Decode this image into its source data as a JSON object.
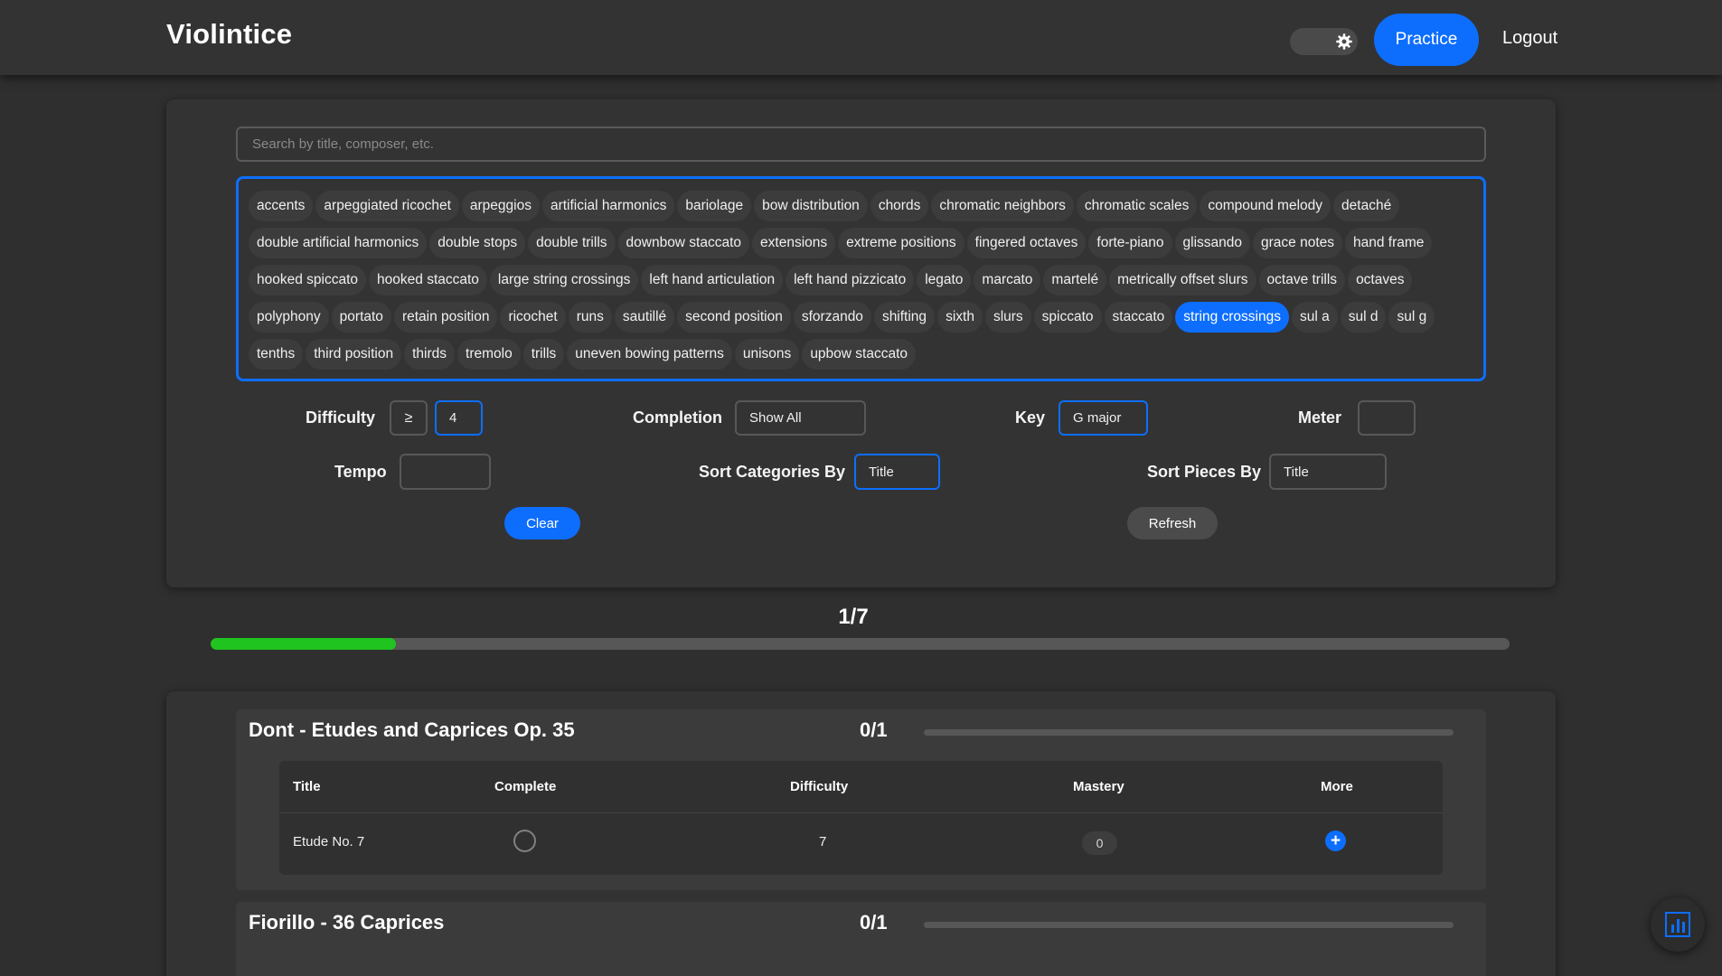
{
  "header": {
    "brand": "Violintice",
    "practice_label": "Practice",
    "logout_label": "Logout",
    "theme_icon": "gear-icon"
  },
  "search": {
    "placeholder": "Search by title, composer, etc.",
    "value": ""
  },
  "tags": [
    {
      "label": "accents",
      "selected": false
    },
    {
      "label": "arpeggiated ricochet",
      "selected": false
    },
    {
      "label": "arpeggios",
      "selected": false
    },
    {
      "label": "artificial harmonics",
      "selected": false
    },
    {
      "label": "bariolage",
      "selected": false
    },
    {
      "label": "bow distribution",
      "selected": false
    },
    {
      "label": "chords",
      "selected": false
    },
    {
      "label": "chromatic neighbors",
      "selected": false
    },
    {
      "label": "chromatic scales",
      "selected": false
    },
    {
      "label": "compound melody",
      "selected": false
    },
    {
      "label": "detaché",
      "selected": false
    },
    {
      "label": "double artificial harmonics",
      "selected": false
    },
    {
      "label": "double stops",
      "selected": false
    },
    {
      "label": "double trills",
      "selected": false
    },
    {
      "label": "downbow staccato",
      "selected": false
    },
    {
      "label": "extensions",
      "selected": false
    },
    {
      "label": "extreme positions",
      "selected": false
    },
    {
      "label": "fingered octaves",
      "selected": false
    },
    {
      "label": "forte-piano",
      "selected": false
    },
    {
      "label": "glissando",
      "selected": false
    },
    {
      "label": "grace notes",
      "selected": false
    },
    {
      "label": "hand frame",
      "selected": false
    },
    {
      "label": "hooked spiccato",
      "selected": false
    },
    {
      "label": "hooked staccato",
      "selected": false
    },
    {
      "label": "large string crossings",
      "selected": false
    },
    {
      "label": "left hand articulation",
      "selected": false
    },
    {
      "label": "left hand pizzicato",
      "selected": false
    },
    {
      "label": "legato",
      "selected": false
    },
    {
      "label": "marcato",
      "selected": false
    },
    {
      "label": "martelé",
      "selected": false
    },
    {
      "label": "metrically offset slurs",
      "selected": false
    },
    {
      "label": "octave trills",
      "selected": false
    },
    {
      "label": "octaves",
      "selected": false
    },
    {
      "label": "polyphony",
      "selected": false
    },
    {
      "label": "portato",
      "selected": false
    },
    {
      "label": "retain position",
      "selected": false
    },
    {
      "label": "ricochet",
      "selected": false
    },
    {
      "label": "runs",
      "selected": false
    },
    {
      "label": "sautillé",
      "selected": false
    },
    {
      "label": "second position",
      "selected": false
    },
    {
      "label": "sforzando",
      "selected": false
    },
    {
      "label": "shifting",
      "selected": false
    },
    {
      "label": "sixth",
      "selected": false
    },
    {
      "label": "slurs",
      "selected": false
    },
    {
      "label": "spiccato",
      "selected": false
    },
    {
      "label": "staccato",
      "selected": false
    },
    {
      "label": "string crossings",
      "selected": true
    },
    {
      "label": "sul a",
      "selected": false
    },
    {
      "label": "sul d",
      "selected": false
    },
    {
      "label": "sul g",
      "selected": false
    },
    {
      "label": "tenths",
      "selected": false
    },
    {
      "label": "third position",
      "selected": false
    },
    {
      "label": "thirds",
      "selected": false
    },
    {
      "label": "tremolo",
      "selected": false
    },
    {
      "label": "trills",
      "selected": false
    },
    {
      "label": "uneven bowing patterns",
      "selected": false
    },
    {
      "label": "unisons",
      "selected": false
    },
    {
      "label": "upbow staccato",
      "selected": false
    }
  ],
  "filters": {
    "difficulty_label": "Difficulty",
    "difficulty_operator": "≥",
    "difficulty_value": "4",
    "completion_label": "Completion",
    "completion_value": "Show All",
    "key_label": "Key",
    "key_value": "G major",
    "meter_label": "Meter",
    "meter_value": "",
    "tempo_label": "Tempo",
    "tempo_value": "",
    "sort_categories_label": "Sort Categories By",
    "sort_categories_value": "Title",
    "sort_pieces_label": "Sort Pieces By",
    "sort_pieces_value": "Title",
    "clear_label": "Clear",
    "refresh_label": "Refresh"
  },
  "progress": {
    "text": "1/7",
    "fraction": 0.1429,
    "color": "#1fc41f"
  },
  "table_headers": [
    "Title",
    "Complete",
    "Difficulty",
    "Mastery",
    "More"
  ],
  "categories": [
    {
      "title": "Dont - Etudes and Caprices Op. 35",
      "count": "0/1",
      "fraction": 0,
      "pieces": [
        {
          "title": "Etude No. 7",
          "complete": false,
          "difficulty": "7",
          "mastery": "0"
        }
      ]
    },
    {
      "title": "Fiorillo - 36 Caprices",
      "count": "0/1",
      "fraction": 0,
      "pieces": []
    }
  ],
  "colors": {
    "accent": "#0d6efd",
    "background": "#2f2f2f",
    "panel": "#333333",
    "success": "#1fc41f"
  },
  "stats_icon": "bar-chart-icon"
}
